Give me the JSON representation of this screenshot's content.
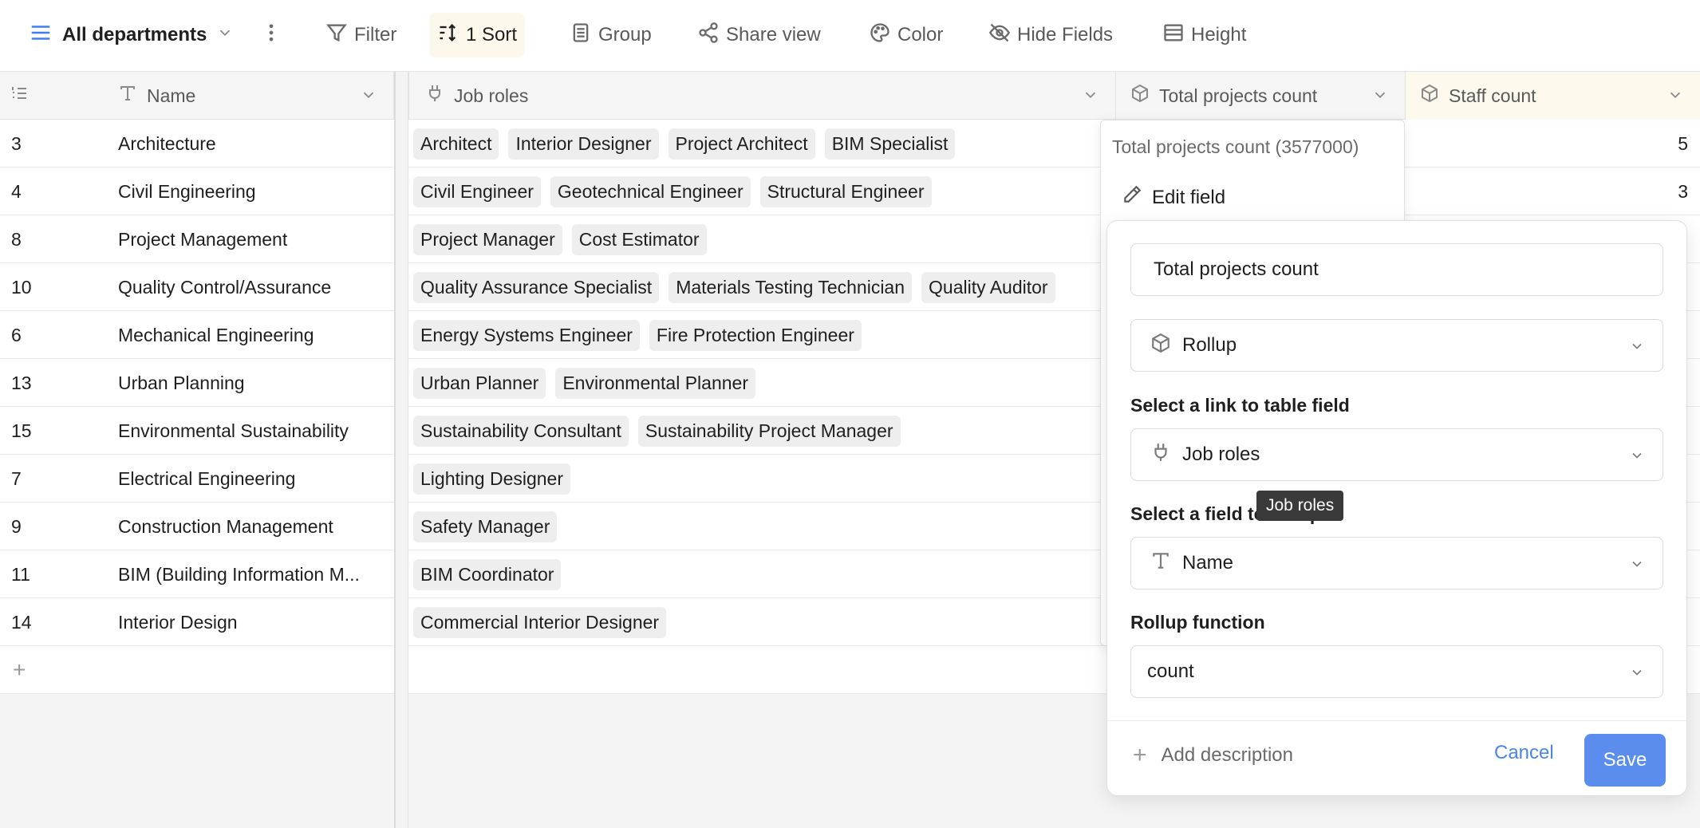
{
  "toolbar": {
    "view_label": "All departments",
    "filter_label": "Filter",
    "sort_label": "1 Sort",
    "group_label": "Group",
    "share_label": "Share view",
    "color_label": "Color",
    "hide_label": "Hide Fields",
    "height_label": "Height"
  },
  "columns": {
    "name": "Name",
    "roles": "Job roles",
    "total": "Total projects count",
    "staff": "Staff count"
  },
  "rows": [
    {
      "id": "3",
      "name": "Architecture",
      "roles": [
        "Architect",
        "Interior Designer",
        "Project Architect",
        "BIM Specialist"
      ],
      "staff": "5"
    },
    {
      "id": "4",
      "name": "Civil Engineering",
      "roles": [
        "Civil Engineer",
        "Geotechnical Engineer",
        "Structural Engineer"
      ],
      "staff": "3"
    },
    {
      "id": "8",
      "name": "Project Management",
      "roles": [
        "Project Manager",
        "Cost Estimator"
      ],
      "staff": ""
    },
    {
      "id": "10",
      "name": "Quality Control/Assurance",
      "roles": [
        "Quality Assurance Specialist",
        "Materials Testing Technician",
        "Quality Auditor"
      ],
      "staff": ""
    },
    {
      "id": "6",
      "name": "Mechanical Engineering",
      "roles": [
        "Energy Systems Engineer",
        "Fire Protection Engineer"
      ],
      "staff": ""
    },
    {
      "id": "13",
      "name": "Urban Planning",
      "roles": [
        "Urban Planner",
        "Environmental Planner"
      ],
      "staff": ""
    },
    {
      "id": "15",
      "name": "Environmental Sustainability",
      "roles": [
        "Sustainability Consultant",
        "Sustainability Project Manager"
      ],
      "staff": ""
    },
    {
      "id": "7",
      "name": "Electrical Engineering",
      "roles": [
        "Lighting Designer"
      ],
      "staff": ""
    },
    {
      "id": "9",
      "name": "Construction Management",
      "roles": [
        "Safety Manager"
      ],
      "staff": ""
    },
    {
      "id": "11",
      "name": "BIM (Building Information M...",
      "roles": [
        "BIM Coordinator"
      ],
      "staff": ""
    },
    {
      "id": "14",
      "name": "Interior Design",
      "roles": [
        "Commercial Interior Designer"
      ],
      "staff": ""
    }
  ],
  "field_menu": {
    "title": "Total projects count (3577000)",
    "edit_label": "Edit field"
  },
  "edit_panel": {
    "field_name": "Total projects count",
    "field_type": "Rollup",
    "link_label": "Select a link to table field",
    "link_value": "Job roles",
    "field_label": "Select a field to rollup",
    "field_value": "Name",
    "func_label": "Rollup function",
    "func_value": "count",
    "add_description": "Add description",
    "cancel": "Cancel",
    "save": "Save"
  },
  "tooltip": "Job roles",
  "colors": {
    "accent": "#3f7ef2",
    "save_button": "#5b8def",
    "sort_highlight": "#fdf8ec",
    "staff_header": "#fdf9ec"
  },
  "icons": [
    "menu-icon",
    "chevron-down-icon",
    "more-vertical-icon",
    "filter-icon",
    "sort-icon",
    "group-icon",
    "share-icon",
    "palette-icon",
    "eye-off-icon",
    "height-icon",
    "text-field-icon",
    "link-plug-icon",
    "rollup-box-icon",
    "pencil-icon",
    "plus-icon"
  ]
}
